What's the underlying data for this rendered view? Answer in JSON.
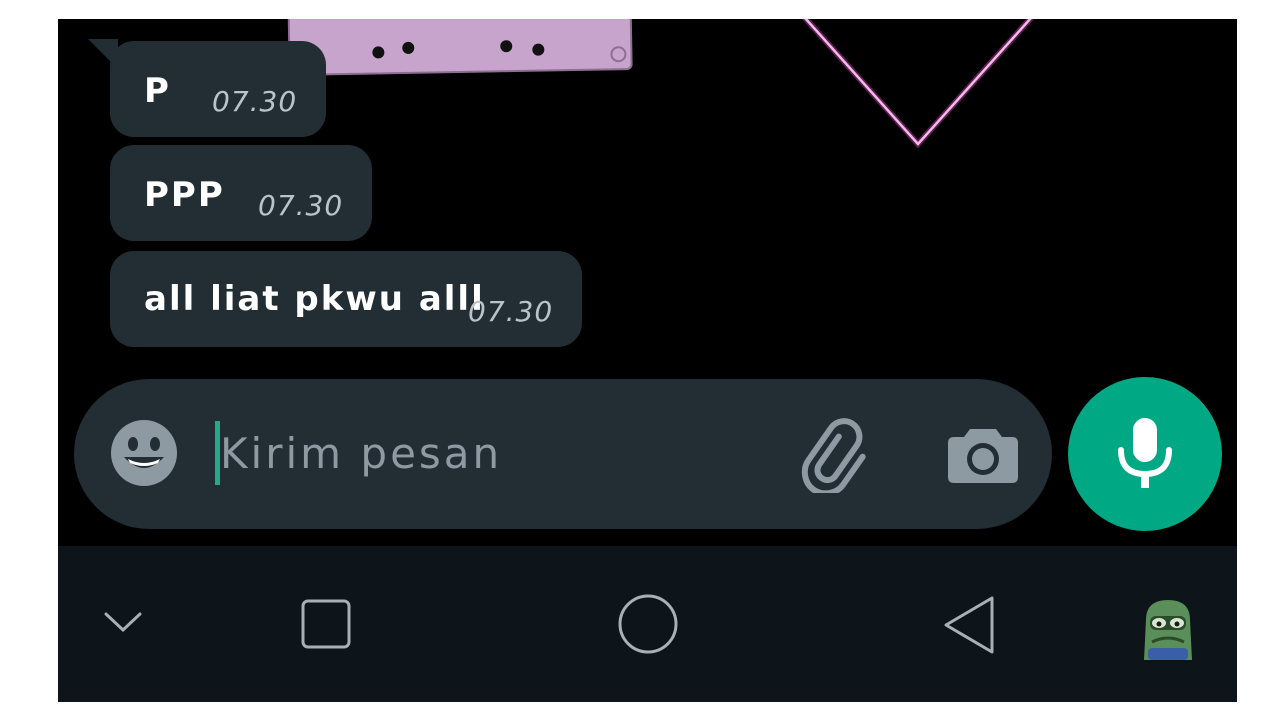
{
  "chat": {
    "messages": [
      {
        "text": "P",
        "time": "07.30"
      },
      {
        "text": "PPP",
        "time": "07.30"
      },
      {
        "text": "all liat pkwu alll",
        "time": "07.30"
      }
    ]
  },
  "composer": {
    "placeholder": "Kirim pesan"
  },
  "icons": {
    "emoji": "smiley-icon",
    "attach": "paperclip-icon",
    "camera": "camera-icon",
    "mic": "microphone-icon",
    "nav_collapse": "chevron-down-icon",
    "nav_recents": "square-icon",
    "nav_home": "circle-icon",
    "nav_back": "triangle-back-icon",
    "nav_sticker": "frog-sticker-icon"
  },
  "colors": {
    "accent": "#00a884",
    "bubble": "#232d34",
    "navbar": "#0d141a",
    "cursor": "#25a98a"
  }
}
